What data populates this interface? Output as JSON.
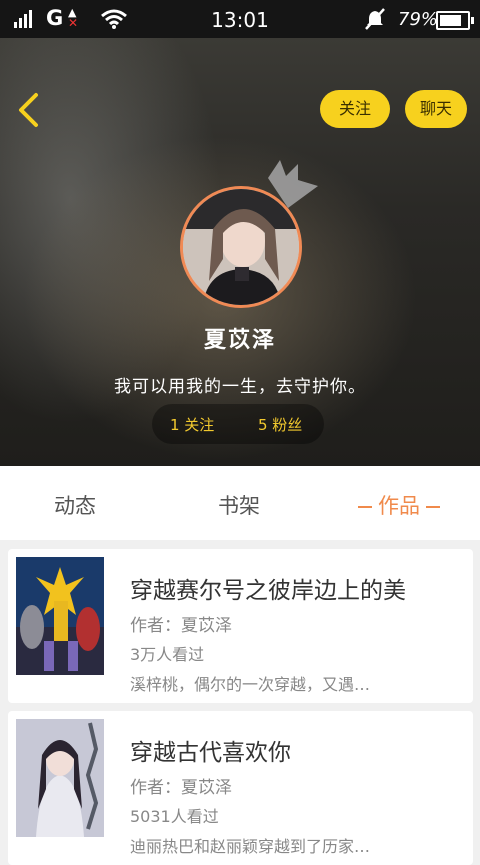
{
  "status_bar": {
    "network": "G",
    "time": "13:01",
    "battery_percent": "79%",
    "battery_level": 0.79
  },
  "header": {
    "follow_button": "关注",
    "chat_button": "聊天",
    "name": "夏苡泽",
    "motto": "我可以用我的一生，去守护你。",
    "follows_text": "1 关注",
    "fans_text": "5 粉丝"
  },
  "tabs": [
    {
      "label": "动态"
    },
    {
      "label": "书架"
    },
    {
      "label": "作品",
      "active": true
    }
  ],
  "works": [
    {
      "title": "穿越赛尔号之彼岸边上的美",
      "author": "作者：夏苡泽",
      "views": "3万人看过",
      "desc": "溪梓桃，偶尔的一次穿越，又遇…"
    },
    {
      "title": "穿越古代喜欢你",
      "author": "作者：夏苡泽",
      "views": "5031人看过",
      "desc": "迪丽热巴和赵丽颖穿越到了历家…"
    }
  ],
  "colors": {
    "accent_yellow": "#f7d11e",
    "active_tab": "#f08a4b",
    "stats_text": "#f2c92e"
  },
  "icons": [
    "signal-icon",
    "no-sim-icon",
    "wifi-icon",
    "mute-icon",
    "battery-icon",
    "back-icon",
    "crown-icon"
  ]
}
